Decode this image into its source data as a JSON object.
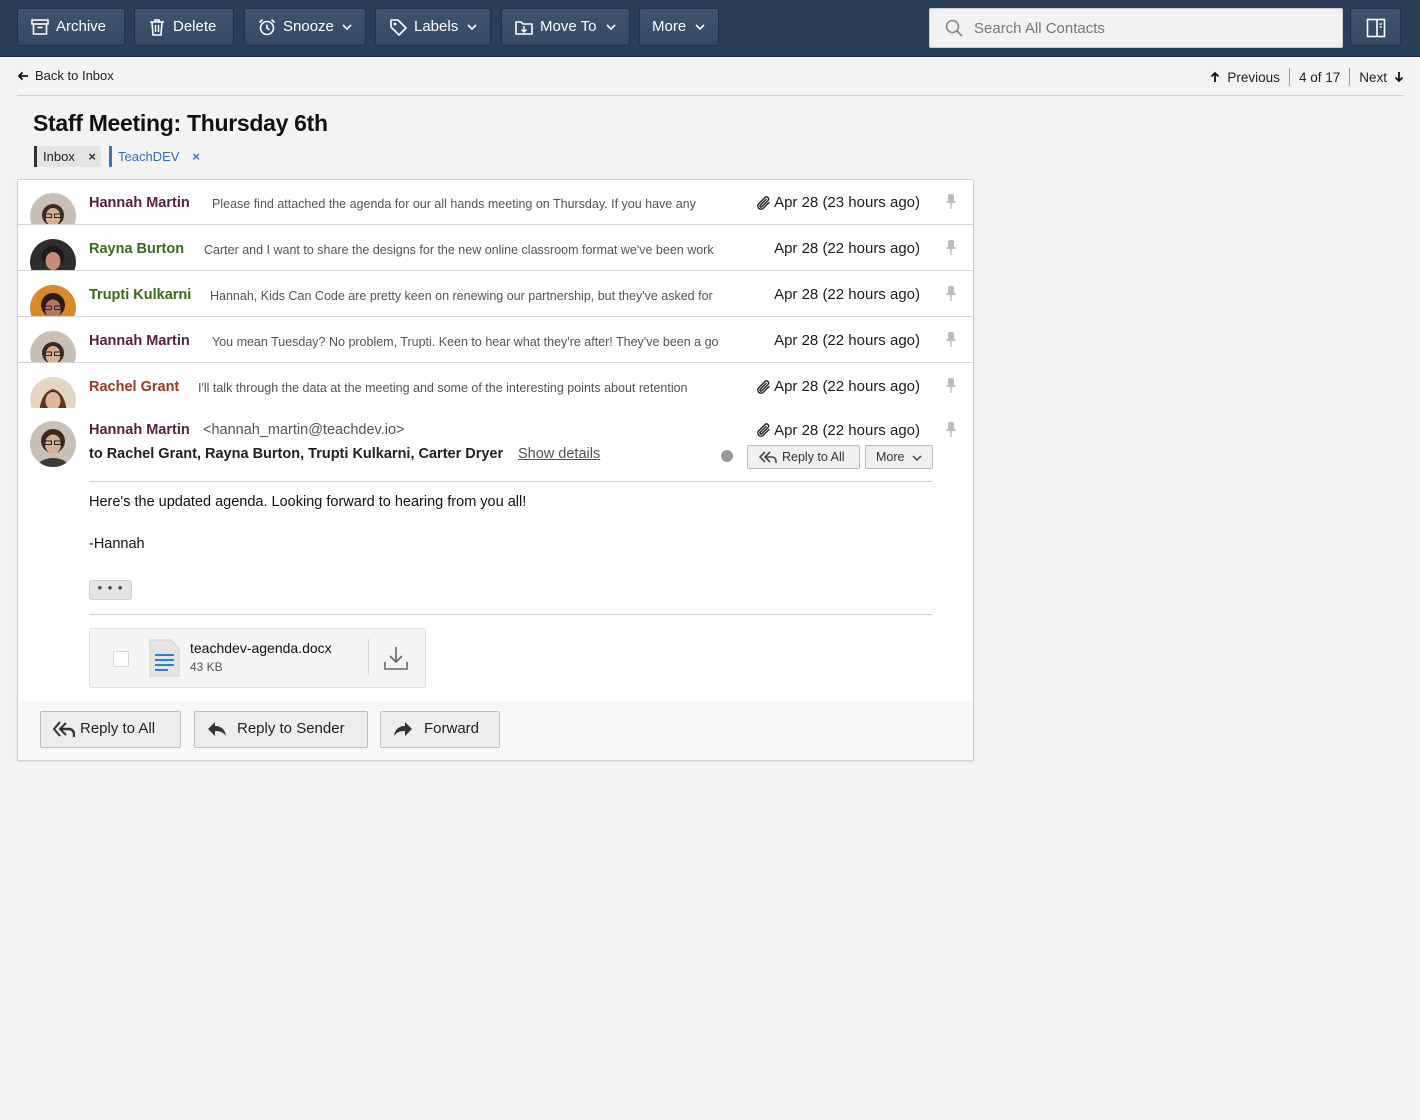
{
  "toolbar": {
    "archive": "Archive",
    "delete": "Delete",
    "snooze": "Snooze",
    "labels": "Labels",
    "move_to": "Move To",
    "more": "More",
    "search_placeholder": "Search All Contacts"
  },
  "nav": {
    "back": "Back to Inbox",
    "previous": "Previous",
    "position": "4 of 17",
    "next": "Next"
  },
  "subject": "Staff Meeting: Thursday 6th",
  "tags": [
    {
      "label": "Inbox",
      "close": "×"
    },
    {
      "label": "TeachDEV",
      "close": "×"
    }
  ],
  "messages": [
    {
      "sender": "Hannah Martin",
      "color": "#5b1f3f",
      "snippet": "Please find attached the agenda for our all hands meeting on Thursday. If you have any",
      "date": "Apr 28 (23 hours ago)",
      "attachment": true
    },
    {
      "sender": "Rayna Burton",
      "color": "#3a6b1a",
      "snippet": "Carter and I want to share the designs for the new online classroom format we've been work",
      "date": "Apr 28 (22 hours ago)",
      "attachment": false
    },
    {
      "sender": "Trupti Kulkarni",
      "color": "#3a6b1a",
      "snippet": "Hannah, Kids Can Code are pretty keen on renewing our partnership, but they've asked for",
      "date": "Apr 28 (22 hours ago)",
      "attachment": false
    },
    {
      "sender": "Hannah Martin",
      "color": "#5b1f3f",
      "snippet": "You mean Tuesday? No problem, Trupti. Keen to hear what they're after! They've been a go",
      "date": "Apr 28 (22 hours ago)",
      "attachment": false
    },
    {
      "sender": "Rachel Grant",
      "color": "#a33a22",
      "snippet": "I'll talk through the data at the meeting and some of the interesting points about retention",
      "date": "Apr 28 (22 hours ago)",
      "attachment": true
    }
  ],
  "open_message": {
    "sender": "Hannah Martin",
    "email": "<hannah_martin@teachdev.io>",
    "to": "to Rachel Grant, Rayna Burton, Trupti Kulkarni, Carter Dryer",
    "show_details": "Show details",
    "date": "Apr 28 (22 hours ago)",
    "reply_all": "Reply to All",
    "more": "More",
    "body_line1": "Here's the updated agenda. Looking forward to hearing from you all!",
    "body_line2": "-Hannah",
    "ellipsis": "• • •",
    "attachment": {
      "name": "teachdev-agenda.docx",
      "size": "43 KB"
    }
  },
  "footer": {
    "reply_all": "Reply to All",
    "reply_sender": "Reply to Sender",
    "forward": "Forward"
  },
  "colors": {
    "toolbar_bg": "#2c3d58",
    "accent_blue": "#2f77c6"
  }
}
